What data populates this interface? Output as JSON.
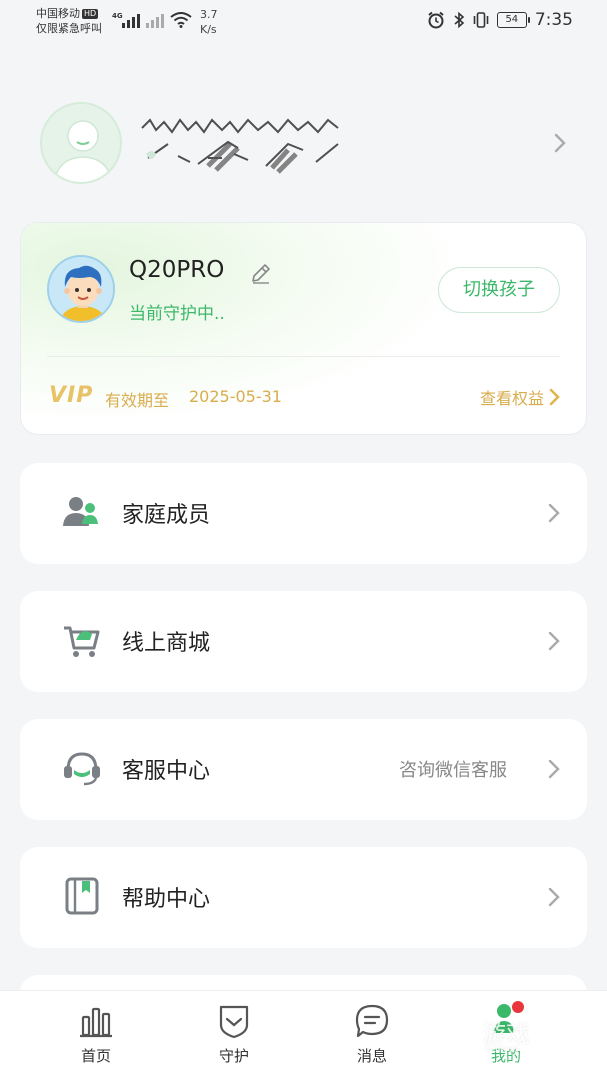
{
  "status_bar": {
    "carrier": "中国移动",
    "hd": "HD",
    "emergency": "仅限紧急呼叫",
    "network": "4G",
    "speed_value": "3.7",
    "speed_unit": "K/s",
    "battery": "54",
    "time": "7:35"
  },
  "profile": {
    "avatar_icon": "user-avatar-icon",
    "name_masked": true
  },
  "child": {
    "name": "Q20PRO",
    "status": "当前守护中..",
    "switch_label": "切换孩子",
    "vip_mark": "VIP",
    "vip_label": "有效期至",
    "vip_date": "2025-05-31",
    "vip_link": "查看权益"
  },
  "menu": [
    {
      "label": "家庭成员",
      "hint": "",
      "icon": "family-members-icon"
    },
    {
      "label": "线上商城",
      "hint": "",
      "icon": "shopping-cart-icon"
    },
    {
      "label": "客服中心",
      "hint": "咨询微信客服",
      "icon": "customer-service-icon"
    },
    {
      "label": "帮助中心",
      "hint": "",
      "icon": "help-book-icon"
    }
  ],
  "nav": [
    {
      "label": "首页",
      "icon": "home-chart-icon",
      "active": false
    },
    {
      "label": "守护",
      "icon": "shield-icon",
      "active": false
    },
    {
      "label": "消息",
      "icon": "message-icon",
      "active": false
    },
    {
      "label": "我的",
      "icon": "me-icon",
      "active": true
    }
  ],
  "watermark": {
    "text": "游戏",
    "sub": "Games"
  },
  "colors": {
    "accent_green": "#3cb86a",
    "vip_gold": "#d8ad4d",
    "background": "#f4f5f7"
  }
}
